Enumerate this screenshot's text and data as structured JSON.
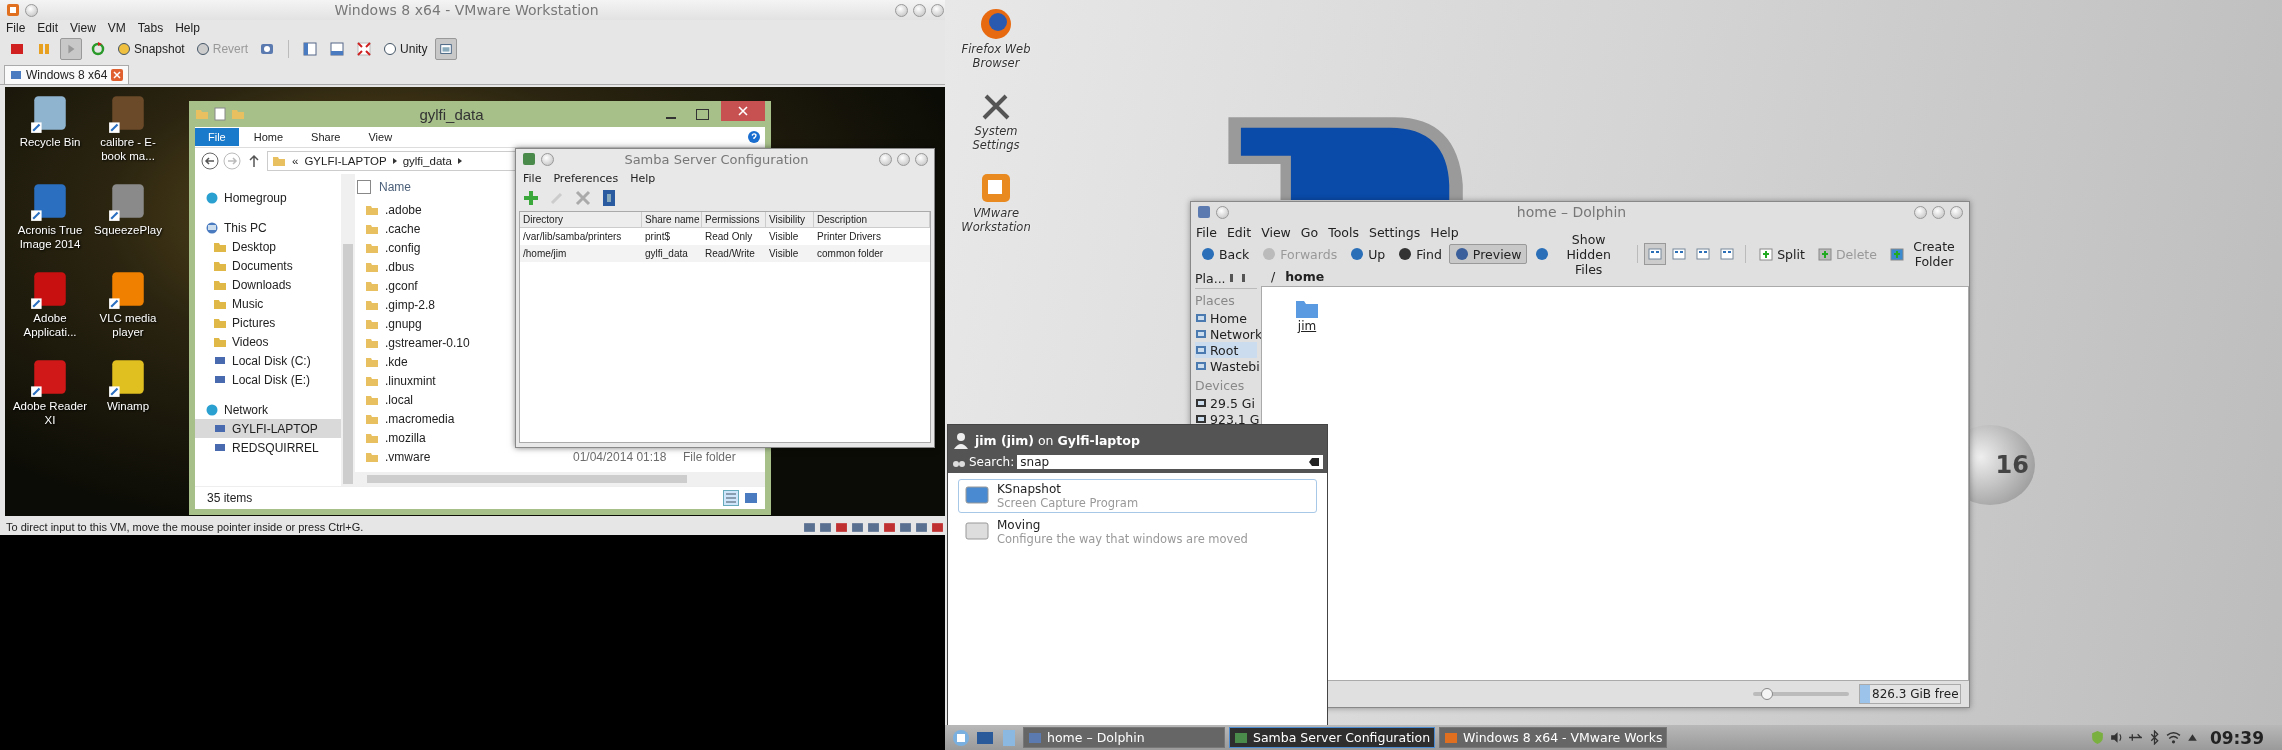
{
  "vmware": {
    "title": "Windows 8 x64 - VMware Workstation",
    "menu": [
      "File",
      "Edit",
      "View",
      "VM",
      "Tabs",
      "Help"
    ],
    "toolbar": [
      {
        "label": "Snapshot",
        "disabled": false
      },
      {
        "label": "Revert",
        "disabled": true
      },
      {
        "label": "Unity",
        "disabled": false
      }
    ],
    "tab": {
      "label": "Windows 8 x64",
      "selected": true
    },
    "status": "To direct input to this VM, move the mouse pointer inside or press Ctrl+G."
  },
  "guest_icons": [
    {
      "label": "Recycle Bin"
    },
    {
      "label": "calibre - E-book ma..."
    },
    {
      "label": "Acronis True Image 2014"
    },
    {
      "label": "SqueezePlay"
    },
    {
      "label": "Adobe Applicati..."
    },
    {
      "label": "VLC media player"
    },
    {
      "label": "Adobe Reader XI"
    },
    {
      "label": "Winamp"
    }
  ],
  "explorer": {
    "title": "gylfi_data",
    "ribbon_tabs": [
      {
        "label": "File",
        "selected": true
      },
      {
        "label": "Home",
        "selected": false
      },
      {
        "label": "Share",
        "selected": false
      },
      {
        "label": "View",
        "selected": false
      }
    ],
    "breadcrumb": [
      "«",
      "GYLFI-LAPTOP",
      "gylfi_data"
    ],
    "nav": [
      {
        "label": "Homegroup",
        "selected": false
      },
      {
        "label": "This PC",
        "selected": false,
        "children": [
          {
            "label": "Desktop",
            "selected": false
          },
          {
            "label": "Documents",
            "selected": false
          },
          {
            "label": "Downloads",
            "selected": false
          },
          {
            "label": "Music",
            "selected": false
          },
          {
            "label": "Pictures",
            "selected": false
          },
          {
            "label": "Videos",
            "selected": false
          },
          {
            "label": "Local Disk (C:)",
            "selected": false
          },
          {
            "label": "Local Disk (E:)",
            "selected": false
          }
        ]
      },
      {
        "label": "Network",
        "selected": false,
        "children": [
          {
            "label": "GYLFI-LAPTOP",
            "selected": true
          },
          {
            "label": "REDSQUIRREL",
            "selected": false
          }
        ]
      }
    ],
    "column": "Name",
    "column_checked": false,
    "files": [
      {
        "name": ".adobe"
      },
      {
        "name": ".cache"
      },
      {
        "name": ".config"
      },
      {
        "name": ".dbus"
      },
      {
        "name": ".gconf"
      },
      {
        "name": ".gimp-2.8"
      },
      {
        "name": ".gnupg"
      },
      {
        "name": ".gstreamer-0.10"
      },
      {
        "name": ".kde"
      },
      {
        "name": ".linuxmint"
      },
      {
        "name": ".local"
      },
      {
        "name": ".macromedia"
      },
      {
        "name": ".mozilla"
      },
      {
        "name": ".vmware",
        "date": "01/04/2014 01:18",
        "type": "File folder"
      }
    ],
    "status": "35 items"
  },
  "samba": {
    "title": "Samba Server Configuration",
    "menu": [
      "File",
      "Preferences",
      "Help"
    ],
    "columns": [
      "Directory",
      "Share name",
      "Permissions",
      "Visibility",
      "Description"
    ],
    "rows": [
      [
        "/var/lib/samba/printers",
        "print$",
        "Read Only",
        "Visible",
        "Printer Drivers"
      ],
      [
        "/home/jim",
        "gylfi_data",
        "Read/Write",
        "Visible",
        "common folder"
      ]
    ]
  },
  "desktop_icons": [
    {
      "label": "Firefox Web Browser"
    },
    {
      "label": "System Settings"
    },
    {
      "label": "VMware Workstation"
    }
  ],
  "wallpaper_badge": "16",
  "dolphin": {
    "title": "home – Dolphin",
    "menu": [
      "File",
      "Edit",
      "View",
      "Go",
      "Tools",
      "Settings",
      "Help"
    ],
    "toolbar": [
      {
        "label": "Back",
        "disabled": false
      },
      {
        "label": "Forwards",
        "disabled": true
      },
      {
        "label": "Up",
        "disabled": false
      },
      {
        "label": "Find",
        "disabled": false
      },
      {
        "label": "Preview",
        "disabled": false,
        "checked": true
      },
      {
        "label": "Show Hidden Files",
        "disabled": false,
        "checked": false
      }
    ],
    "view_modes": [
      {
        "selected": true
      },
      {
        "selected": false
      },
      {
        "selected": false
      },
      {
        "selected": false
      }
    ],
    "toolbar2": [
      {
        "label": "Split",
        "disabled": false
      },
      {
        "label": "Delete",
        "disabled": true
      },
      {
        "label": "Create Folder",
        "disabled": false
      }
    ],
    "panel_title": "Pla...",
    "places": [
      {
        "title": "Places",
        "items": [
          {
            "label": "Home",
            "selected": false
          },
          {
            "label": "Network",
            "selected": false
          },
          {
            "label": "Root",
            "selected": true
          },
          {
            "label": "Wastebi",
            "selected": false
          }
        ]
      },
      {
        "title": "Devices",
        "items": [
          {
            "label": "29.5 Gi",
            "selected": false
          },
          {
            "label": "923.1 G",
            "selected": false
          }
        ]
      }
    ],
    "path": [
      "/",
      "home"
    ],
    "items": [
      {
        "name": "jim"
      }
    ],
    "zoom": {
      "level": 0.15
    },
    "free": {
      "label": "826.3 GiB free",
      "level": 0.1
    }
  },
  "krunner": {
    "user": "**jim (jim)** on **Gylfi-laptop**",
    "search_label": "Search:",
    "query": "snap",
    "results": [
      {
        "title": "KSnapshot",
        "subtitle": "Screen Capture Program",
        "selected": true
      },
      {
        "title": "Moving",
        "subtitle": "Configure the way that windows are moved",
        "selected": false
      }
    ]
  },
  "taskbar": {
    "tasks": [
      {
        "label": "home – Dolphin",
        "selected": false
      },
      {
        "label": "Samba Server Configuration",
        "selected": true
      },
      {
        "label": "Windows 8 x64 - VMware Works",
        "selected": false
      }
    ],
    "clock": "09:39"
  }
}
